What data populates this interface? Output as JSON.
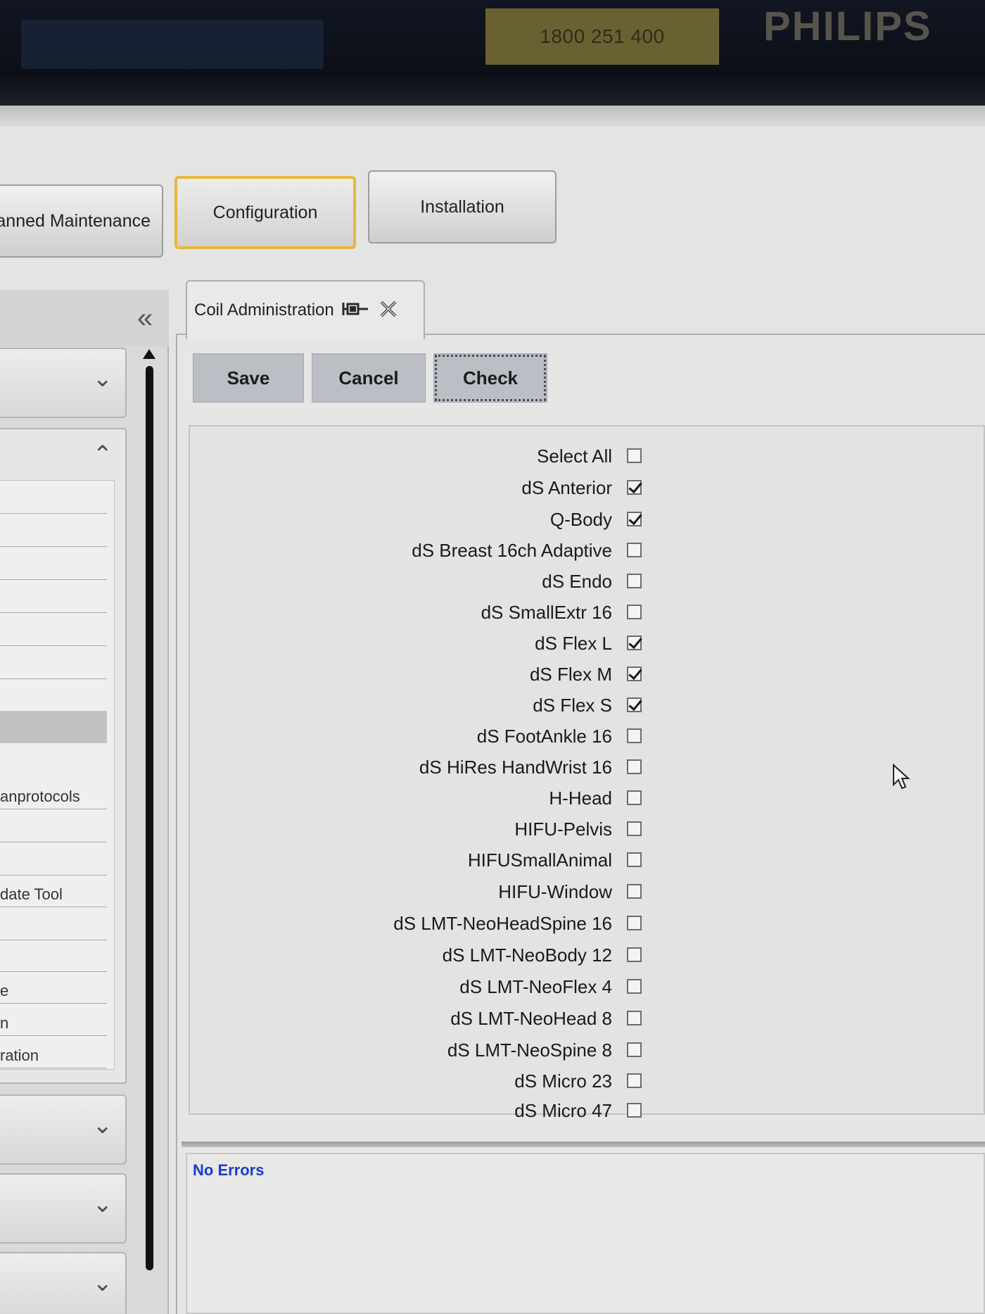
{
  "header": {
    "phone": "1800 251 400",
    "brand": "PHILIPS"
  },
  "top_tabs": [
    {
      "label": "Planned Maintenance",
      "visible_label": "lanned Maintenance",
      "active": false
    },
    {
      "label": "Configuration",
      "active": true
    },
    {
      "label": "Installation",
      "active": false
    }
  ],
  "left_nav": {
    "collapse_icon": "double-chevron-left-icon",
    "items": [
      "",
      "",
      "",
      "",
      "",
      "",
      "",
      "",
      "anprotocols",
      "",
      "",
      "date Tool",
      "",
      "",
      "e",
      "n",
      "ration"
    ],
    "selected_index": 7
  },
  "document_tab": {
    "title": "Coil Administration",
    "pin_icon": "pin-icon",
    "close_icon": "close-icon"
  },
  "actions": {
    "save": "Save",
    "cancel": "Cancel",
    "check": "Check"
  },
  "coils": [
    {
      "label": "Select All",
      "checked": false
    },
    {
      "label": "dS Anterior",
      "checked": true
    },
    {
      "label": "Q-Body",
      "checked": true
    },
    {
      "label": "dS Breast 16ch Adaptive",
      "checked": false
    },
    {
      "label": "dS Endo",
      "checked": false
    },
    {
      "label": "dS SmallExtr 16",
      "checked": false
    },
    {
      "label": "dS Flex L",
      "checked": true
    },
    {
      "label": "dS Flex M",
      "checked": true
    },
    {
      "label": "dS Flex S",
      "checked": true
    },
    {
      "label": "dS FootAnkle 16",
      "checked": false
    },
    {
      "label": "dS HiRes HandWrist 16",
      "checked": false
    },
    {
      "label": "H-Head",
      "checked": false
    },
    {
      "label": "HIFU-Pelvis",
      "checked": false
    },
    {
      "label": "HIFUSmallAnimal",
      "checked": false
    },
    {
      "label": "HIFU-Window",
      "checked": false
    },
    {
      "label": "dS LMT-NeoHeadSpine 16",
      "checked": false
    },
    {
      "label": "dS LMT-NeoBody 12",
      "checked": false
    },
    {
      "label": "dS LMT-NeoFlex 4",
      "checked": false
    },
    {
      "label": "dS LMT-NeoHead 8",
      "checked": false
    },
    {
      "label": "dS LMT-NeoSpine 8",
      "checked": false
    },
    {
      "label": "dS Micro 23",
      "checked": false
    },
    {
      "label": "dS Micro 47",
      "checked": false
    }
  ],
  "status": {
    "text": "No Errors",
    "color": "#1b3cc8"
  },
  "colors": {
    "active_tab_border": "#e6b73d",
    "button_bg": "#bcbec6"
  }
}
